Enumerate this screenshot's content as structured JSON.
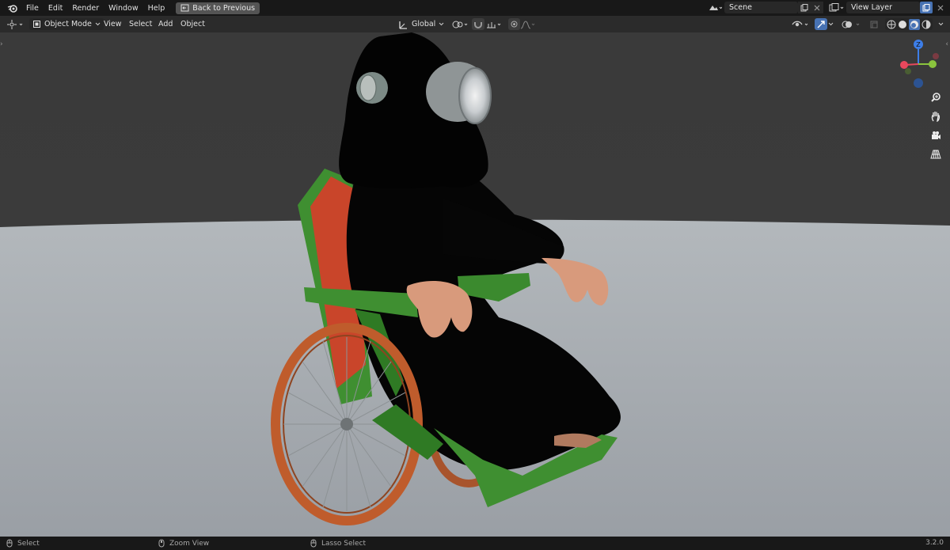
{
  "topbar": {
    "menus": [
      "File",
      "Edit",
      "Render",
      "Window",
      "Help"
    ],
    "back_button": "Back to Previous",
    "scene": "Scene",
    "view_layer": "View Layer"
  },
  "header": {
    "mode": "Object Mode",
    "menus": [
      "View",
      "Select",
      "Add",
      "Object"
    ],
    "transform_orientation": "Global"
  },
  "gizmo": {
    "z_label": "Z",
    "colors": {
      "x": "#e8485c",
      "y": "#8ac43d",
      "z": "#3d7ee8"
    }
  },
  "statusbar": {
    "select": "Select",
    "zoom": "Zoom View",
    "lasso": "Lasso Select",
    "version": "3.2.0"
  },
  "scene_colors": {
    "background": "#3b3b3b",
    "floor": "#a9aeb3",
    "robe": "#050505",
    "chair_frame": "#3c8b2e",
    "wheel": "#b8582a",
    "seat_cushion": "#c6462a",
    "skin": "#d89a7c"
  }
}
